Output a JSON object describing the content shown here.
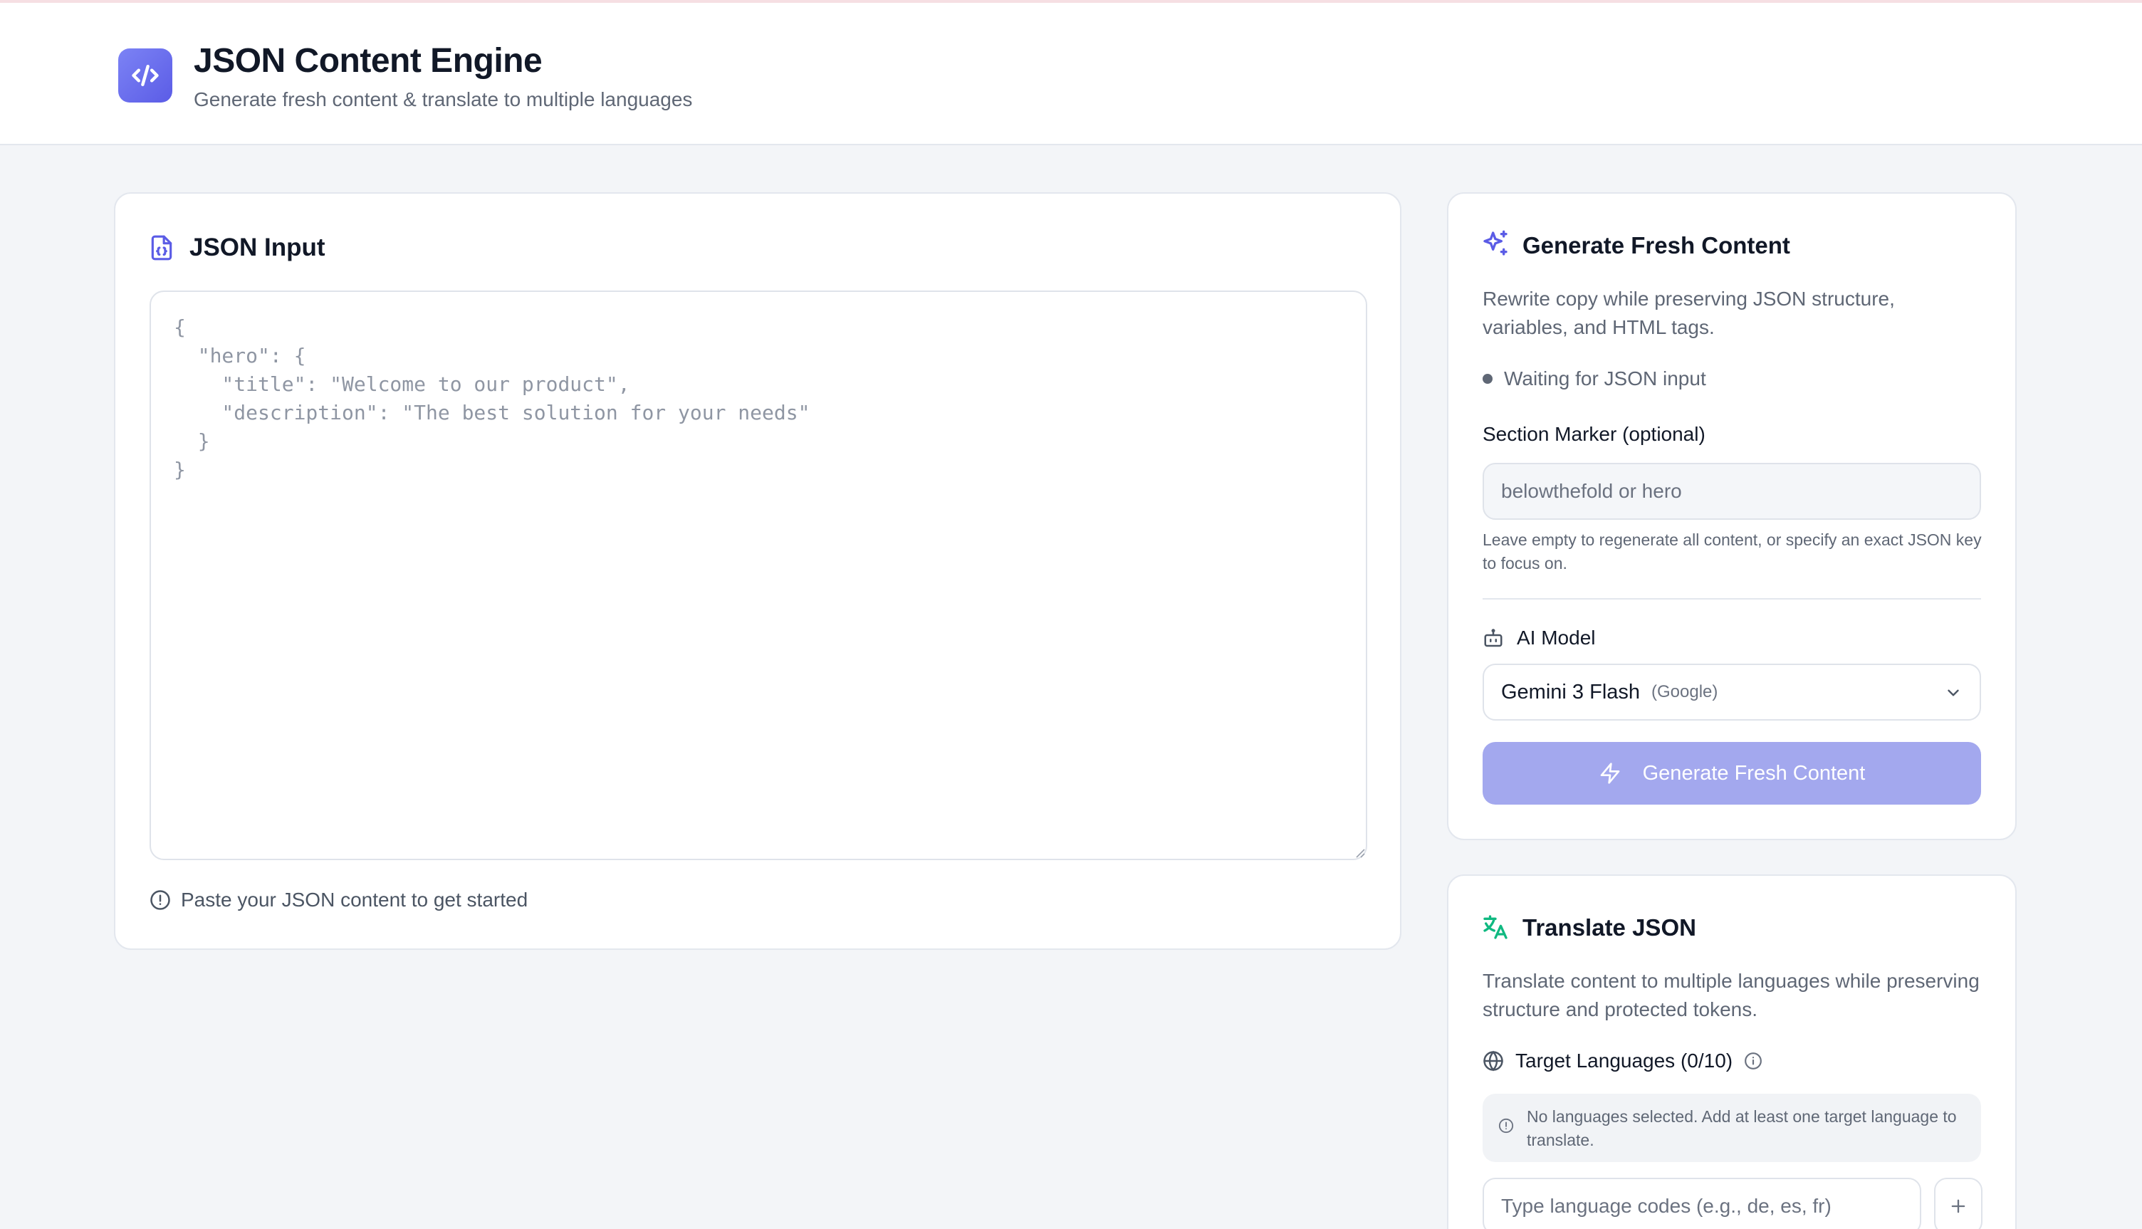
{
  "header": {
    "title": "JSON Content Engine",
    "subtitle": "Generate fresh content & translate to multiple languages",
    "logo_icon": "code-icon"
  },
  "json_input": {
    "title": "JSON Input",
    "title_icon": "file-json-icon",
    "placeholder": "{\n  \"hero\": {\n    \"title\": \"Welcome to our product\",\n    \"description\": \"The best solution for your needs\"\n  }\n}",
    "value": "",
    "hint": "Paste your JSON content to get started",
    "hint_icon": "alert-circle-icon"
  },
  "generate": {
    "title": "Generate Fresh Content",
    "title_icon": "sparkles-icon",
    "description": "Rewrite copy while preserving JSON structure, variables, and HTML tags.",
    "status": "Waiting for JSON input",
    "section_marker_label": "Section Marker (optional)",
    "section_marker_placeholder": "belowthefold or hero",
    "section_marker_value": "",
    "section_marker_help": "Leave empty to regenerate all content, or specify an exact JSON key to focus on.",
    "model_label": "AI Model",
    "model_icon": "bot-icon",
    "model_name": "Gemini 3 Flash",
    "model_provider": "(Google)",
    "button_label": "Generate Fresh Content",
    "button_icon": "zap-icon",
    "button_disabled": true
  },
  "translate": {
    "title": "Translate JSON",
    "title_icon": "languages-icon",
    "description": "Translate content to multiple languages while preserving structure and protected tokens.",
    "target_label": "Target Languages (0/10)",
    "target_icon": "globe-icon",
    "info_icon": "info-icon",
    "empty_notice": "No languages selected. Add at least one target language to translate.",
    "lang_input_placeholder": "Type language codes (e.g., de, es, fr)",
    "lang_input_value": "",
    "add_icon": "plus-icon"
  },
  "colors": {
    "accent": "#5b5ce6",
    "accent_disabled": "#a3a8ee",
    "translate_icon": "#10b981",
    "background": "#f3f5f8"
  }
}
